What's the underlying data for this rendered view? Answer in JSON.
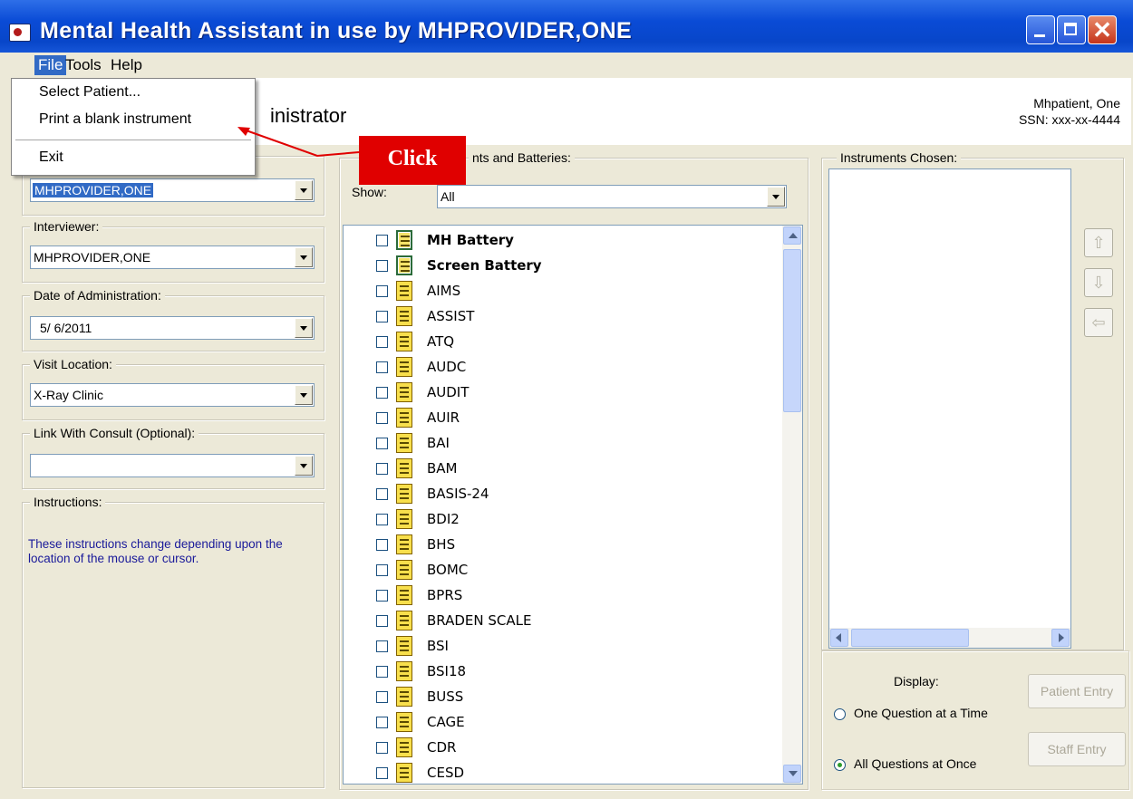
{
  "window": {
    "title": "Mental Health Assistant in use by MHPROVIDER,ONE",
    "close_glyph": "✕"
  },
  "menubar": {
    "items": [
      "File",
      "Tools",
      "Help"
    ]
  },
  "file_menu": {
    "items": [
      "Select Patient...",
      "Print a blank instrument",
      "Exit"
    ]
  },
  "header": {
    "title": "inistrator",
    "patient_name": "Mhpatient, One",
    "patient_ssn": "SSN: xxx-xx-4444"
  },
  "left_panel": {
    "orderedby_value": "MHPROVIDER,ONE",
    "interviewer": {
      "label": "Interviewer:",
      "value": "MHPROVIDER,ONE"
    },
    "date": {
      "label": "Date of Administration:",
      "value": "5/ 6/2011"
    },
    "location": {
      "label": "Visit Location:",
      "value": "X-Ray Clinic"
    },
    "consult": {
      "label": "Link With Consult (Optional):",
      "value": ""
    },
    "instructions": {
      "label": "Instructions:",
      "text": "These instructions change depending upon the location of the mouse or cursor."
    }
  },
  "middle_panel": {
    "label": "nts and Batteries:",
    "show_label": "Show:",
    "show_value": "All",
    "items": [
      {
        "label": "MH Battery",
        "bold": true,
        "kind": "battery"
      },
      {
        "label": "Screen Battery",
        "bold": true,
        "kind": "battery"
      },
      {
        "label": "AIMS"
      },
      {
        "label": "ASSIST"
      },
      {
        "label": "ATQ"
      },
      {
        "label": "AUDC"
      },
      {
        "label": "AUDIT"
      },
      {
        "label": "AUIR"
      },
      {
        "label": "BAI"
      },
      {
        "label": "BAM"
      },
      {
        "label": "BASIS-24"
      },
      {
        "label": "BDI2"
      },
      {
        "label": "BHS"
      },
      {
        "label": "BOMC"
      },
      {
        "label": "BPRS"
      },
      {
        "label": "BRADEN SCALE"
      },
      {
        "label": "BSI"
      },
      {
        "label": "BSI18"
      },
      {
        "label": "BUSS"
      },
      {
        "label": "CAGE"
      },
      {
        "label": "CDR"
      },
      {
        "label": "CESD"
      }
    ]
  },
  "right_panel": {
    "label": "Instruments Chosen:",
    "display_label": "Display:",
    "radio_one": "One Question at a Time",
    "radio_all": "All Questions at Once",
    "selected_mode": "All Questions at Once",
    "patient_entry": "Patient Entry",
    "staff_entry": "Staff Entry",
    "side_glyphs": [
      "⇧",
      "⇩",
      "⇦"
    ]
  },
  "callout": {
    "text": "Click",
    "color": "#E00000"
  },
  "colors": {
    "titlebar": "#0A4BD6",
    "selection": "#316AC5",
    "window_bg": "#ECE9D8",
    "instructions_text": "#1a1a9a"
  }
}
